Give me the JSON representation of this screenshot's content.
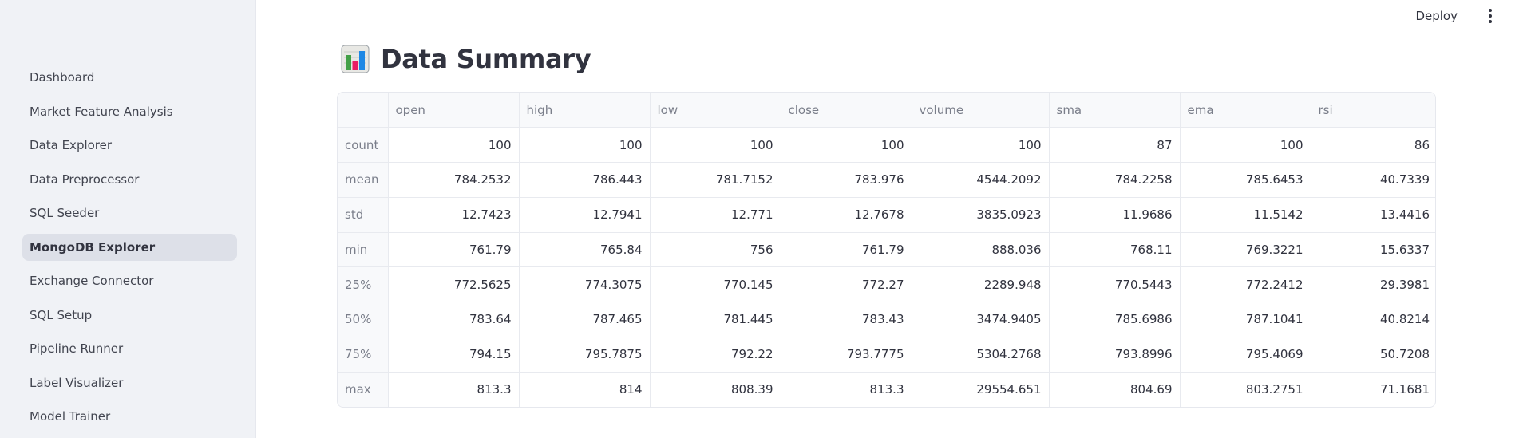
{
  "sidebar": {
    "items": [
      {
        "label": "Dashboard",
        "active": false
      },
      {
        "label": "Market Feature Analysis",
        "active": false
      },
      {
        "label": "Data Explorer",
        "active": false
      },
      {
        "label": "Data Preprocessor",
        "active": false
      },
      {
        "label": "SQL Seeder",
        "active": false
      },
      {
        "label": "MongoDB Explorer",
        "active": true
      },
      {
        "label": "Exchange Connector",
        "active": false
      },
      {
        "label": "SQL Setup",
        "active": false
      },
      {
        "label": "Pipeline Runner",
        "active": false
      },
      {
        "label": "Label Visualizer",
        "active": false
      },
      {
        "label": "Model Trainer",
        "active": false
      }
    ]
  },
  "header": {
    "deploy_label": "Deploy",
    "menu_icon": "kebab-menu-icon"
  },
  "main": {
    "title": "Data Summary",
    "title_icon": "bar-chart-icon",
    "table": {
      "index_header": "",
      "columns": [
        "open",
        "high",
        "low",
        "close",
        "volume",
        "sma",
        "ema",
        "rsi"
      ],
      "rows": [
        {
          "label": "count",
          "values": [
            "100",
            "100",
            "100",
            "100",
            "100",
            "87",
            "100",
            "86"
          ]
        },
        {
          "label": "mean",
          "values": [
            "784.2532",
            "786.443",
            "781.7152",
            "783.976",
            "4544.2092",
            "784.2258",
            "785.6453",
            "40.7339"
          ]
        },
        {
          "label": "std",
          "values": [
            "12.7423",
            "12.7941",
            "12.771",
            "12.7678",
            "3835.0923",
            "11.9686",
            "11.5142",
            "13.4416"
          ]
        },
        {
          "label": "min",
          "values": [
            "761.79",
            "765.84",
            "756",
            "761.79",
            "888.036",
            "768.11",
            "769.3221",
            "15.6337"
          ]
        },
        {
          "label": "25%",
          "values": [
            "772.5625",
            "774.3075",
            "770.145",
            "772.27",
            "2289.948",
            "770.5443",
            "772.2412",
            "29.3981"
          ]
        },
        {
          "label": "50%",
          "values": [
            "783.64",
            "787.465",
            "781.445",
            "783.43",
            "3474.9405",
            "785.6986",
            "787.1041",
            "40.8214"
          ]
        },
        {
          "label": "75%",
          "values": [
            "794.15",
            "795.7875",
            "792.22",
            "793.7775",
            "5304.2768",
            "793.8996",
            "795.4069",
            "50.7208"
          ]
        },
        {
          "label": "max",
          "values": [
            "813.3",
            "814",
            "808.39",
            "813.3",
            "29554.651",
            "804.69",
            "803.2751",
            "71.1681"
          ]
        }
      ]
    }
  }
}
